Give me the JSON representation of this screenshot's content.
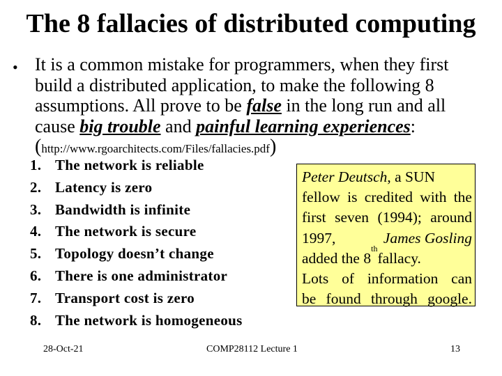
{
  "slide": {
    "title": "The 8 fallacies of distributed computing",
    "bullet_symbol": "•",
    "intro": {
      "text_1": "It is a common mistake for programmers, when they first build a distributed application, to make the following 8 assumptions. All prove to be ",
      "emph_1": "false",
      "text_2": " in the long run and all cause ",
      "emph_2": "big trouble",
      "text_3": " and ",
      "emph_3": "painful learning experiences",
      "text_4": ":",
      "url": "http://www.rgoarchitects.com/Files/fallacies.pdf"
    },
    "fallacies": [
      {
        "num": "1.",
        "text": "The network is reliable"
      },
      {
        "num": "2.",
        "text": "Latency is zero"
      },
      {
        "num": "3.",
        "text": "Bandwidth is infinite"
      },
      {
        "num": "4.",
        "text": "The network is secure"
      },
      {
        "num": "5.",
        "text": "Topology doesn’t change"
      },
      {
        "num": "6.",
        "text": "There is one administrator"
      },
      {
        "num": "7.",
        "text": "Transport cost is zero"
      },
      {
        "num": "8.",
        "text": "The network is homogeneous"
      }
    ],
    "note": {
      "background_color": "#ffff99",
      "l1_name": "Peter Deutsch",
      "l1_rest": ", a SUN",
      "l2": "fellow is credited with the",
      "l3": "first seven (1994); around",
      "l4_year": "1997,",
      "l4_name": "James Gosling",
      "l5_a": "added the 8",
      "l5_sup": "th",
      "l5_b": " fallacy.",
      "l6": "Lots of information can",
      "l7": "be found through google."
    },
    "footer": {
      "date": "28-Oct-21",
      "course": "COMP28112 Lecture 1",
      "page": "13"
    }
  }
}
